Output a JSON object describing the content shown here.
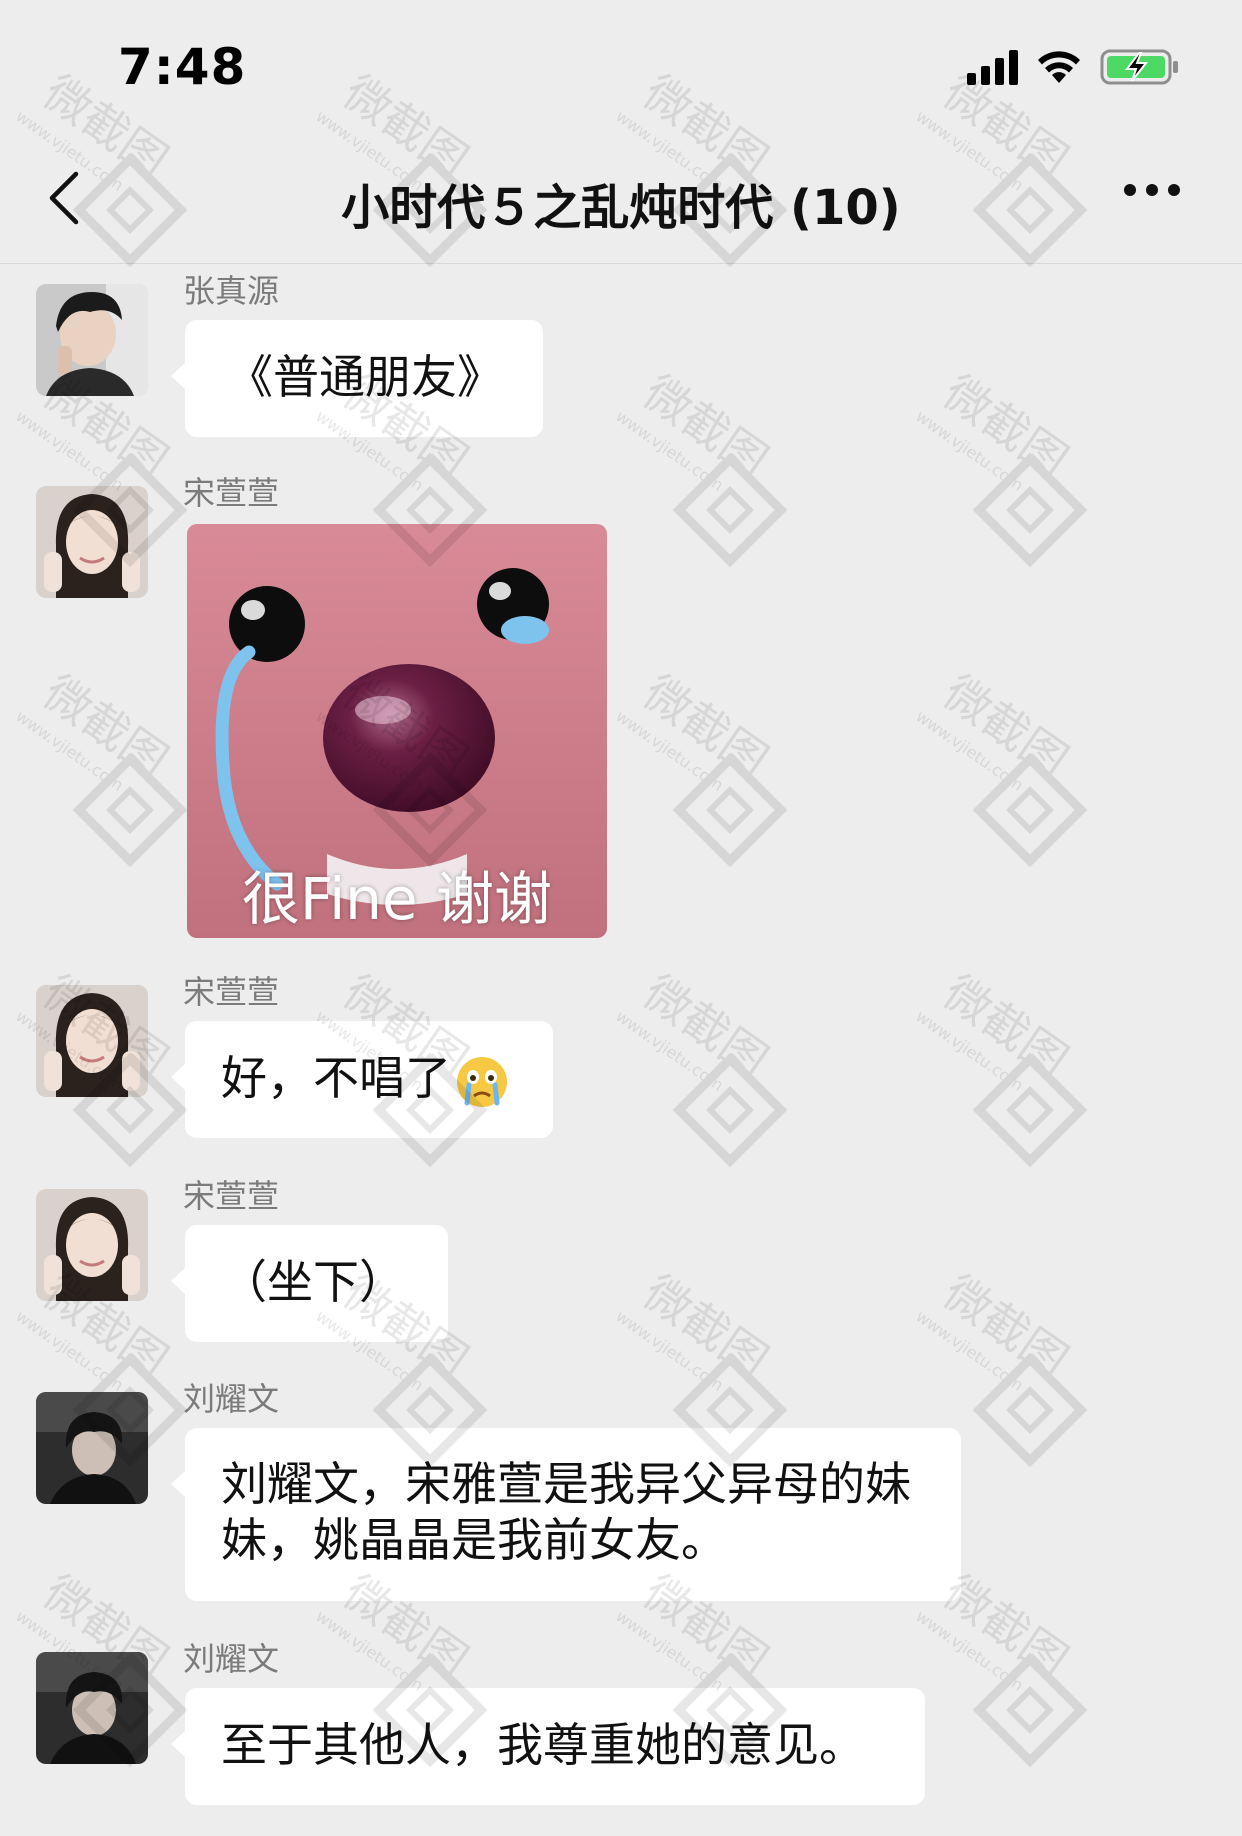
{
  "status_bar": {
    "time": "7:48",
    "signal_icon": "cellular-signal-icon",
    "wifi_icon": "wifi-icon",
    "battery_icon": "battery-charging-icon"
  },
  "header": {
    "title": "小时代５之乱炖时代 (10)",
    "back_icon": "chevron-left-icon",
    "more_icon": "more-dots-icon"
  },
  "messages": [
    {
      "sender": "张真源",
      "type": "text",
      "text": "《普通朋友》"
    },
    {
      "sender": "宋萱萱",
      "type": "sticker",
      "caption": "很Fine 谢谢"
    },
    {
      "sender": "宋萱萱",
      "type": "text",
      "text": "好，不唱了",
      "emoji": "crying-face-emoji"
    },
    {
      "sender": "宋萱萱",
      "type": "text",
      "text": "（坐下）"
    },
    {
      "sender": "刘耀文",
      "type": "text",
      "line1": "刘耀文，宋雅萱是我异父异母的妹",
      "line2": "妹，姚晶晶是我前女友。"
    },
    {
      "sender": "刘耀文",
      "type": "text",
      "text": "至于其他人，我尊重她的意见。"
    }
  ],
  "watermark": {
    "text": "微截图",
    "url": "www.vjietu.com"
  },
  "colors": {
    "background": "#ededed",
    "bubble": "#ffffff",
    "sender_name": "#7b7b7b",
    "battery_green": "#4cd964",
    "sticker_pink": "#d47c8c"
  }
}
